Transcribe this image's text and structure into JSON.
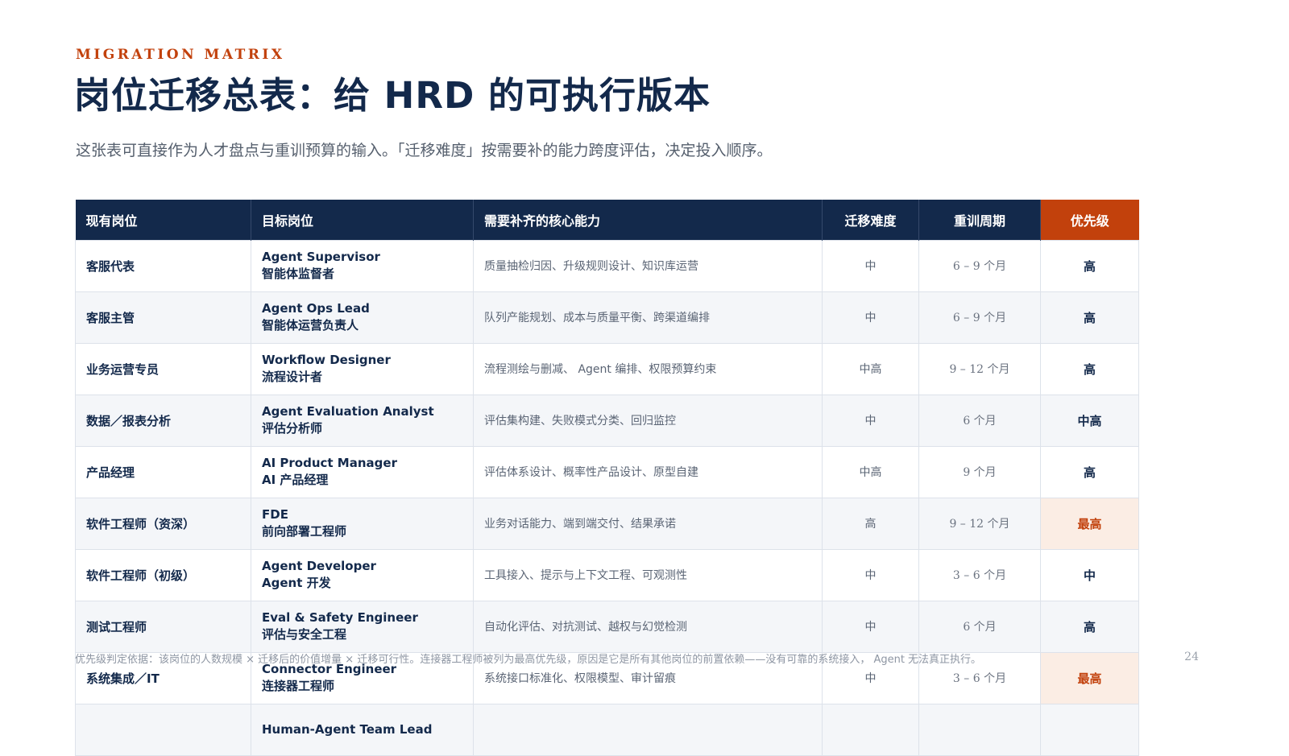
{
  "header": {
    "eyebrow": "MIGRATION MATRIX",
    "title": "岗位迁移总表：给 HRD 的可执行版本",
    "subtitle": "这张表可直接作为人才盘点与重训预算的输入。「迁移难度」按需要补的能力跨度评估，决定投入顺序。"
  },
  "colors": {
    "navy": "#13294b",
    "accent": "#c2410c",
    "accent_bg": "#fbede4"
  },
  "table": {
    "headers": [
      "现有岗位",
      "目标岗位",
      "需要补齐的核心能力",
      "迁移难度",
      "重训周期",
      "优先级"
    ],
    "rows": [
      {
        "current": "客服代表",
        "target_en": "Agent Supervisor",
        "target_zh": "智能体监督者",
        "skills": "质量抽检归因、升级规则设计、知识库运营",
        "difficulty": "中",
        "cycle": "6 – 9 个月",
        "priority": "高",
        "top": false
      },
      {
        "current": "客服主管",
        "target_en": "Agent Ops Lead",
        "target_zh": "智能体运营负责人",
        "skills": "队列产能规划、成本与质量平衡、跨渠道编排",
        "difficulty": "中",
        "cycle": "6 – 9 个月",
        "priority": "高",
        "top": false
      },
      {
        "current": "业务运营专员",
        "target_en": "Workflow Designer",
        "target_zh": "流程设计者",
        "skills": "流程测绘与删减、 Agent 编排、权限预算约束",
        "difficulty": "中高",
        "cycle": "9 – 12 个月",
        "priority": "高",
        "top": false
      },
      {
        "current": "数据／报表分析",
        "target_en": "Agent Evaluation Analyst",
        "target_zh": "评估分析师",
        "skills": "评估集构建、失败模式分类、回归监控",
        "difficulty": "中",
        "cycle": "6 个月",
        "priority": "中高",
        "top": false
      },
      {
        "current": "产品经理",
        "target_en": "AI Product Manager",
        "target_zh": "AI 产品经理",
        "skills": "评估体系设计、概率性产品设计、原型自建",
        "difficulty": "中高",
        "cycle": "9 个月",
        "priority": "高",
        "top": false
      },
      {
        "current": "软件工程师（资深）",
        "target_en": "FDE",
        "target_zh": "前向部署工程师",
        "skills": "业务对话能力、端到端交付、结果承诺",
        "difficulty": "高",
        "cycle": "9 – 12 个月",
        "priority": "最高",
        "top": true
      },
      {
        "current": "软件工程师（初级）",
        "target_en": "Agent Developer",
        "target_zh": "Agent 开发",
        "skills": "工具接入、提示与上下文工程、可观测性",
        "difficulty": "中",
        "cycle": "3 – 6 个月",
        "priority": "中",
        "top": false
      },
      {
        "current": "测试工程师",
        "target_en": "Eval & Safety Engineer",
        "target_zh": "评估与安全工程",
        "skills": "自动化评估、对抗测试、越权与幻觉检测",
        "difficulty": "中",
        "cycle": "6 个月",
        "priority": "高",
        "top": false
      },
      {
        "current": "系统集成／IT",
        "target_en": "Connector Engineer",
        "target_zh": "连接器工程师",
        "skills": "系统接口标准化、权限模型、审计留痕",
        "difficulty": "中",
        "cycle": "3 – 6 个月",
        "priority": "最高",
        "top": true
      },
      {
        "current": "",
        "target_en": "Human-Agent Team Lead",
        "target_zh": "",
        "skills": "",
        "difficulty": "",
        "cycle": "",
        "priority": "",
        "top": false
      }
    ]
  },
  "footnote": "优先级判定依据：该岗位的人数规模 × 迁移后的价值增量 × 迁移可行性。连接器工程师被列为最高优先级，原因是它是所有其他岗位的前置依赖——没有可靠的系统接入， Agent 无法真正执行。",
  "page_number": "24"
}
